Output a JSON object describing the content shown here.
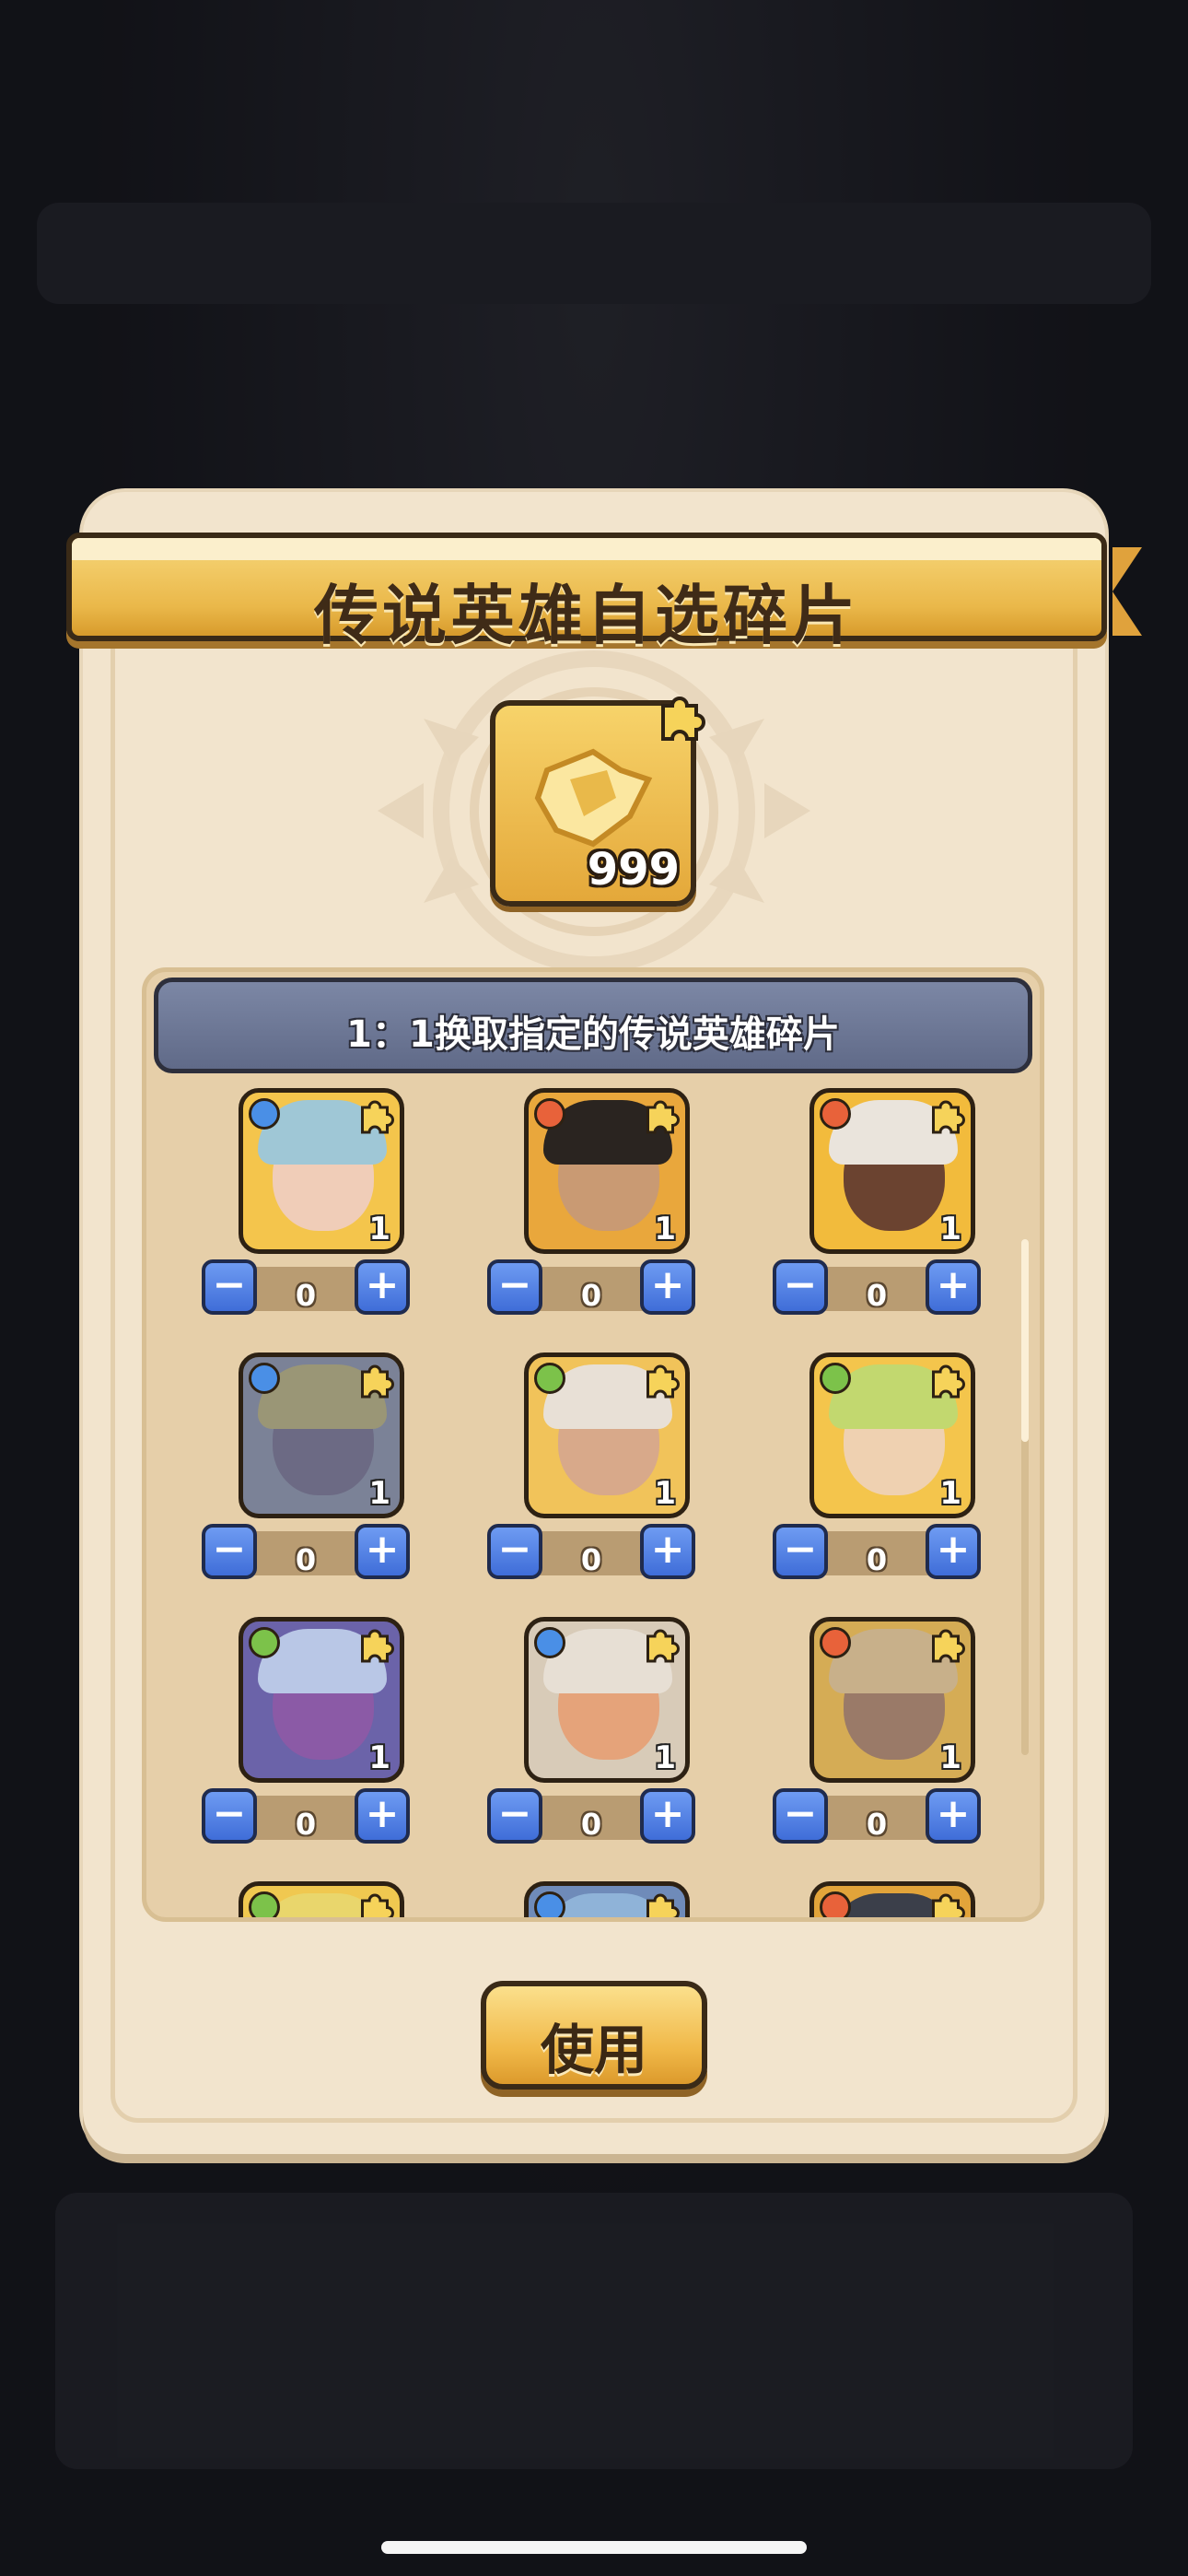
{
  "dialog": {
    "title": "传说英雄自选碎片",
    "featured_item": {
      "icon": "legendary-hero-shard-icon",
      "count": "999"
    },
    "list_header": "1：1换取指定的传说英雄碎片",
    "use_button": "使用"
  },
  "heroes": [
    {
      "element": "water",
      "count": "1",
      "qty": "0",
      "colors": {
        "hair": "#9fc7d6",
        "face": "#f0cdb8",
        "bg": "#f4c54c"
      }
    },
    {
      "element": "fire",
      "count": "1",
      "qty": "0",
      "colors": {
        "hair": "#2a2420",
        "face": "#c99a73",
        "bg": "#e9a73c"
      }
    },
    {
      "element": "fire",
      "count": "1",
      "qty": "0",
      "colors": {
        "hair": "#eae4dc",
        "face": "#6b4330",
        "bg": "#f2bb3c"
      }
    },
    {
      "element": "water",
      "count": "1",
      "qty": "0",
      "colors": {
        "hair": "#9a9676",
        "face": "#6c6a84",
        "bg": "#7b8297"
      }
    },
    {
      "element": "leaf",
      "count": "1",
      "qty": "0",
      "colors": {
        "hair": "#e8e0d6",
        "face": "#d8a98a",
        "bg": "#f1c35a"
      }
    },
    {
      "element": "leaf",
      "count": "1",
      "qty": "0",
      "colors": {
        "hair": "#c2d86f",
        "face": "#efd1b1",
        "bg": "#f4c54c"
      }
    },
    {
      "element": "leaf",
      "count": "1",
      "qty": "0",
      "colors": {
        "hair": "#b9c7e6",
        "face": "#8b5aa6",
        "bg": "#6b63a9"
      }
    },
    {
      "element": "water",
      "count": "1",
      "qty": "0",
      "colors": {
        "hair": "#e7dfd4",
        "face": "#e5a37a",
        "bg": "#d8cbb8"
      }
    },
    {
      "element": "fire",
      "count": "1",
      "qty": "0",
      "colors": {
        "hair": "#c8b08a",
        "face": "#9a7a68",
        "bg": "#d5ac55"
      }
    },
    {
      "element": "leaf",
      "count": "",
      "qty": "",
      "colors": {
        "hair": "#e9d66c",
        "face": "#f0d7a0",
        "bg": "#f0c850"
      }
    },
    {
      "element": "water",
      "count": "",
      "qty": "",
      "colors": {
        "hair": "#8fb3d8",
        "face": "#dde6f2",
        "bg": "#6f8bb9"
      }
    },
    {
      "element": "fire",
      "count": "",
      "qty": "",
      "colors": {
        "hair": "#3b3f4a",
        "face": "#6a6d7a",
        "bg": "#e2a43a"
      }
    }
  ],
  "element_colors": {
    "water": "#4a8fe6",
    "fire": "#e8623a",
    "leaf": "#7cc24a"
  },
  "stepper": {
    "minus": "−",
    "plus": "+"
  }
}
